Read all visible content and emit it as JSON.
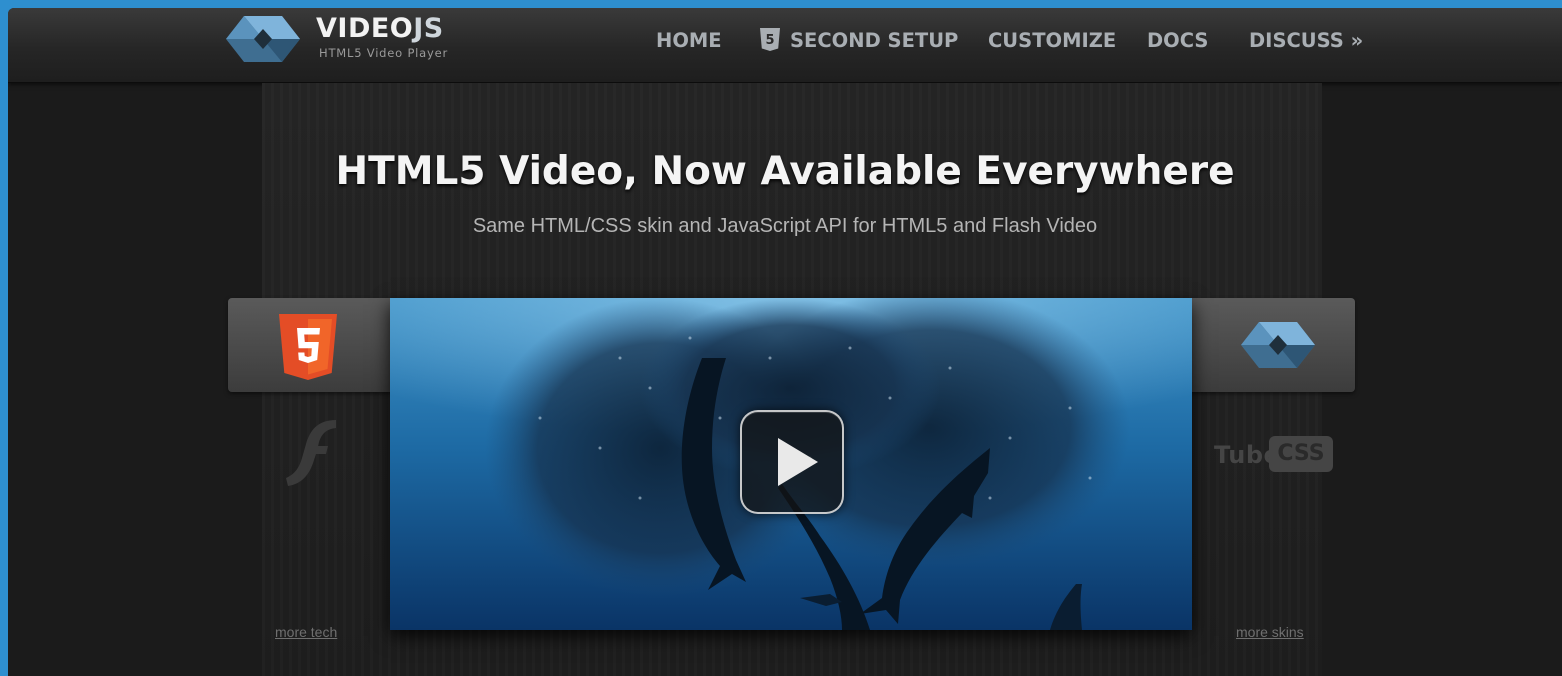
{
  "brand": {
    "name_bold": "VIDEO",
    "name_light": "JS",
    "tagline": "HTML5 Video Player"
  },
  "nav": {
    "items": [
      {
        "label": "HOME"
      },
      {
        "label": "SECOND SETUP",
        "icon": "html5-shield-icon"
      },
      {
        "label": "CUSTOMIZE"
      },
      {
        "label": "DOCS"
      },
      {
        "label": "DISCUSS »"
      }
    ]
  },
  "hero": {
    "title": "HTML5 Video, Now Available Everywhere",
    "subtitle": "Same HTML/CSS skin and JavaScript API for HTML5 and Flash Video"
  },
  "tech": {
    "icons": [
      "html5-logo-icon",
      "flash-logo-icon"
    ],
    "more_link": "more tech"
  },
  "skins": {
    "icons": [
      "videojs-logo-icon"
    ],
    "tube_label": "Tube",
    "css_label": "CSS",
    "more_link": "more skins"
  },
  "video": {
    "play_icon": "play-icon"
  },
  "colors": {
    "page_background": "#1b1b1b",
    "outer_background": "#2e8fcf",
    "nav_text": "#a9aeb3",
    "html5_orange": "#e44d26",
    "videojs_blue": "#6ba3cc"
  }
}
